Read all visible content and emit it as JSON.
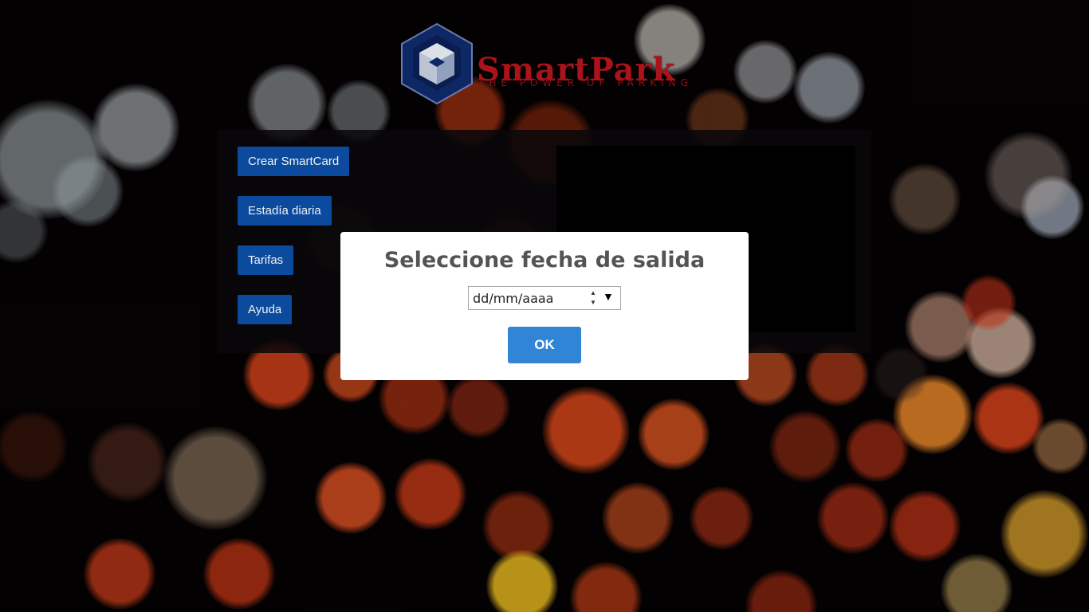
{
  "logo": {
    "title": "SmartPark",
    "tagline": "THE POWER OF PARKING"
  },
  "menu": [
    {
      "label": "Crear SmartCard"
    },
    {
      "label": "Estadía diaria"
    },
    {
      "label": "Tarifas"
    },
    {
      "label": "Ayuda"
    }
  ],
  "modal": {
    "title": "Seleccione fecha de salida",
    "date_placeholder": "dd/mm/aaaa",
    "confirm_label": "OK"
  },
  "colors": {
    "menu_button": "#0c4fa6",
    "confirm_button": "#3085d6",
    "brand_red": "#b3151b",
    "logo_cube": "#0f2a6b"
  },
  "icons": {
    "logo": "cube-logo-icon",
    "spinner": "spinner-icon",
    "calendar_dropdown": "dropdown-arrow-icon"
  }
}
